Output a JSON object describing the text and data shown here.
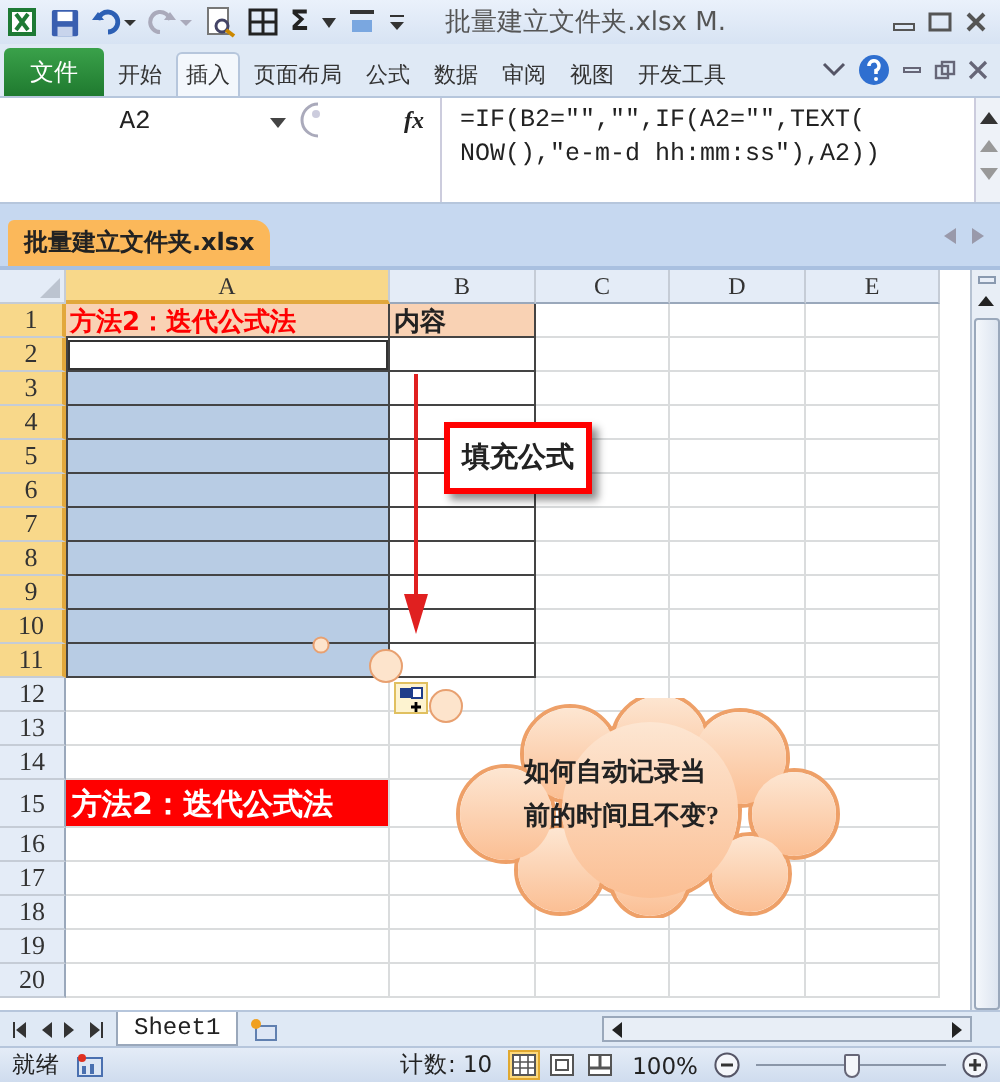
{
  "title_bar": {
    "sigma": "Σ",
    "title": "批量建立文件夹.xlsx M."
  },
  "ribbon_tabs": [
    {
      "label": "文件",
      "kind": "file",
      "selected": false
    },
    {
      "label": "开始",
      "kind": "tab",
      "selected": false
    },
    {
      "label": "插入",
      "kind": "tab",
      "selected": true
    },
    {
      "label": "页面布局",
      "kind": "tab",
      "selected": false
    },
    {
      "label": "公式",
      "kind": "tab",
      "selected": false
    },
    {
      "label": "数据",
      "kind": "tab",
      "selected": false
    },
    {
      "label": "审阅",
      "kind": "tab",
      "selected": false
    },
    {
      "label": "视图",
      "kind": "tab",
      "selected": false
    },
    {
      "label": "开发工具",
      "kind": "tab",
      "selected": false
    }
  ],
  "formula_bar": {
    "name_box": "A2",
    "fx": "fx",
    "lines": [
      "=IF(B2=\"\",\"\",IF(A2=\"\",TEXT(",
      "NOW(),\"e-m-d hh:mm:ss\"),A2))"
    ]
  },
  "workbook_tabs": [
    {
      "label": "批量建立文件夹.xlsx",
      "selected": true
    }
  ],
  "columns": [
    {
      "label": "A",
      "selected": true
    },
    {
      "label": "B",
      "selected": false
    },
    {
      "label": "C",
      "selected": false
    },
    {
      "label": "D",
      "selected": false
    },
    {
      "label": "E",
      "selected": false
    }
  ],
  "rows": [
    {
      "label": "1",
      "selected": true,
      "cells": [
        {
          "kind": "title",
          "text": "方法2：迭代公式法"
        },
        {
          "kind": "header",
          "text": "内容"
        }
      ]
    },
    {
      "label": "2",
      "selected": true,
      "cells": [
        {
          "kind": "active"
        },
        {
          "kind": "plain"
        }
      ]
    },
    {
      "label": "3",
      "selected": true,
      "cells": [
        {
          "kind": "selected"
        },
        {
          "kind": "plain"
        }
      ]
    },
    {
      "label": "4",
      "selected": true,
      "cells": [
        {
          "kind": "selected"
        },
        {
          "kind": "plain"
        }
      ]
    },
    {
      "label": "5",
      "selected": true,
      "cells": [
        {
          "kind": "selected"
        },
        {
          "kind": "plain"
        }
      ]
    },
    {
      "label": "6",
      "selected": true,
      "cells": [
        {
          "kind": "selected"
        },
        {
          "kind": "plain"
        }
      ]
    },
    {
      "label": "7",
      "selected": true,
      "cells": [
        {
          "kind": "selected"
        },
        {
          "kind": "plain"
        }
      ]
    },
    {
      "label": "8",
      "selected": true,
      "cells": [
        {
          "kind": "selected"
        },
        {
          "kind": "plain"
        }
      ]
    },
    {
      "label": "9",
      "selected": true,
      "cells": [
        {
          "kind": "selected"
        },
        {
          "kind": "plain"
        }
      ]
    },
    {
      "label": "10",
      "selected": true,
      "cells": [
        {
          "kind": "selected"
        },
        {
          "kind": "plain"
        }
      ]
    },
    {
      "label": "11",
      "selected": true,
      "cells": [
        {
          "kind": "selected"
        },
        {
          "kind": "plain"
        }
      ]
    },
    {
      "label": "12",
      "selected": false,
      "cells": []
    },
    {
      "label": "13",
      "selected": false,
      "cells": []
    },
    {
      "label": "14",
      "selected": false,
      "cells": []
    },
    {
      "label": "15",
      "selected": false,
      "tall": true,
      "cells": [
        {
          "kind": "banner",
          "text": "方法2：迭代公式法"
        }
      ]
    },
    {
      "label": "16",
      "selected": false,
      "cells": []
    },
    {
      "label": "17",
      "selected": false,
      "cells": []
    },
    {
      "label": "18",
      "selected": false,
      "cells": []
    },
    {
      "label": "19",
      "selected": false,
      "cells": []
    },
    {
      "label": "20",
      "selected": false,
      "cells": []
    }
  ],
  "fill_callout": {
    "text": "填充公式"
  },
  "cloud_callout": {
    "lines": [
      "如何自动记录当",
      "前的时间且不变?"
    ]
  },
  "sheet_tabs": [
    {
      "label": "Sheet1",
      "selected": true
    }
  ],
  "status_bar": {
    "mode": "就绪",
    "count": "计数: 10",
    "views": [
      {
        "kind": "normal",
        "selected": true
      },
      {
        "kind": "layout",
        "selected": false
      },
      {
        "kind": "break",
        "selected": false
      }
    ],
    "zoom": "100%",
    "zoom_slider": {
      "level": 0.5
    }
  }
}
